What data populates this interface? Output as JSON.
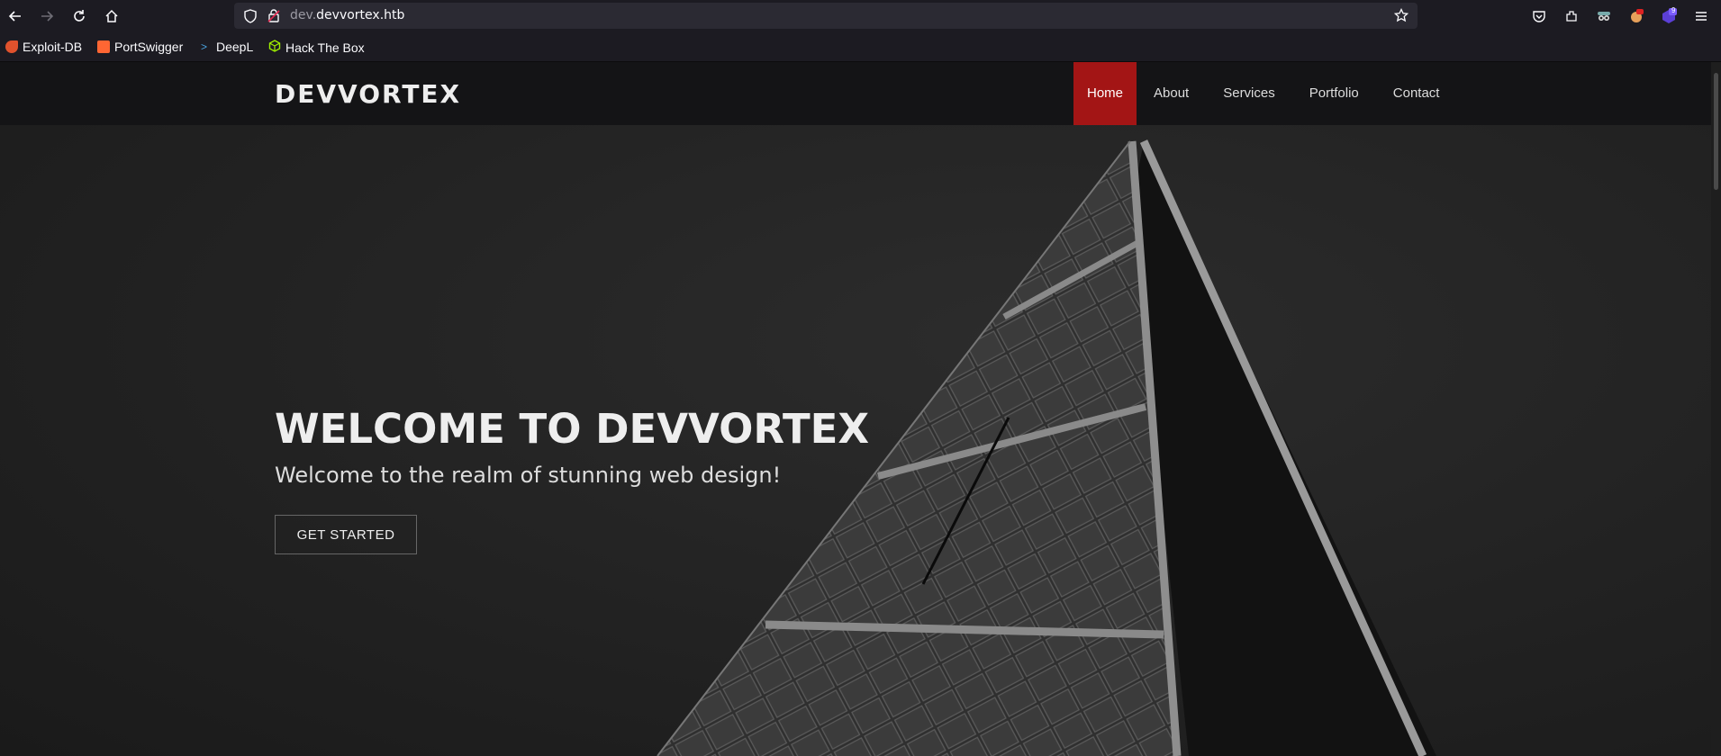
{
  "browser": {
    "url_prefix": "dev.",
    "url_domain": "devvortex.htb",
    "icons": [
      "back-arrow-icon",
      "forward-arrow-icon",
      "reload-icon",
      "home-icon",
      "shield-icon",
      "lock-icon",
      "star-icon",
      "pocket-icon",
      "extensions-icon",
      "account-icon",
      "menu-icon"
    ],
    "extension_badge": "9",
    "bookmarks": [
      {
        "label": "Exploit-DB",
        "icon": "exploit-db-icon",
        "color": "#e0522d"
      },
      {
        "label": "PortSwigger",
        "icon": "portswigger-icon",
        "color": "#ff6633"
      },
      {
        "label": "DeepL",
        "icon": "deepl-icon",
        "color": "#4aa3df"
      },
      {
        "label": "Hack The Box",
        "icon": "htb-cube-icon",
        "color": "#9fef00"
      }
    ]
  },
  "site": {
    "logo": "DEVVORTEX",
    "nav": [
      {
        "label": "Home",
        "active": true
      },
      {
        "label": "About",
        "active": false
      },
      {
        "label": "Services",
        "active": false
      },
      {
        "label": "Portfolio",
        "active": false
      },
      {
        "label": "Contact",
        "active": false
      }
    ],
    "accent": "#a31515"
  },
  "hero": {
    "title": "WELCOME TO DEVVORTEX",
    "subtitle": "Welcome to the realm of stunning web design!",
    "cta": "GET STARTED"
  }
}
